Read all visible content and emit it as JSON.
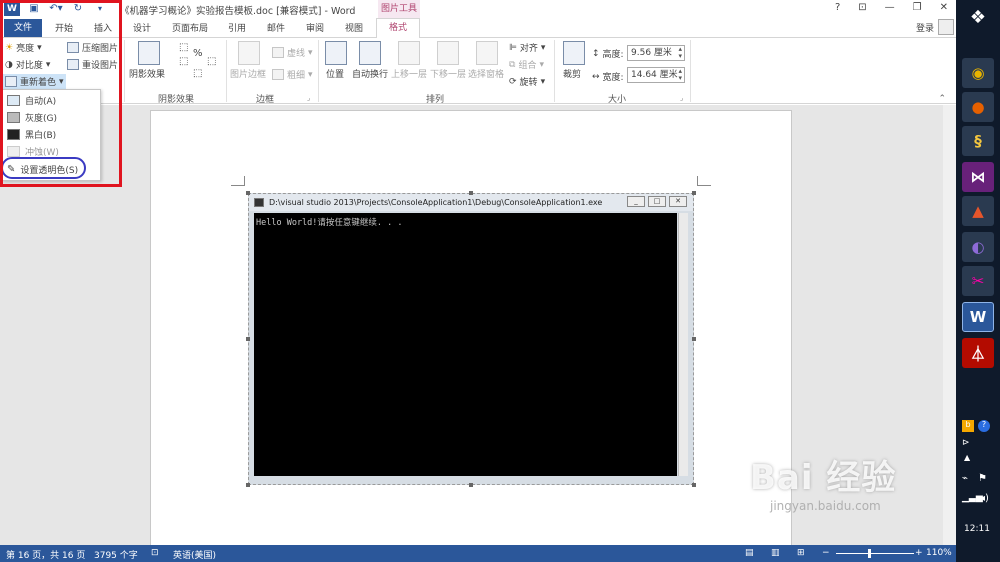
{
  "title_bar": {
    "document_title": "《机器学习概论》实验报告模板.doc [兼容模式] - Word",
    "contextual_tab": "图片工具",
    "help": "?",
    "ribbon_display": "⊡",
    "minimize": "—",
    "restore": "❐",
    "close": "✕"
  },
  "tabs": {
    "file": "文件",
    "home": "开始",
    "insert": "插入",
    "design": "设计",
    "layout": "页面布局",
    "references": "引用",
    "mailings": "邮件",
    "review": "审阅",
    "view": "视图",
    "format": "格式",
    "sign_in": "登录"
  },
  "ribbon": {
    "adjust": {
      "brightness": "亮度",
      "contrast": "对比度",
      "recolor": "重新着色",
      "compress": "压缩图片",
      "reset": "重设图片"
    },
    "shadow": {
      "shadow_effects": "阴影效果",
      "group_label": "阴影效果"
    },
    "border": {
      "picture_border": "图片边框",
      "dashes": "虚线",
      "weight": "粗细",
      "group_label": "边框"
    },
    "arrange": {
      "position": "位置",
      "wrap_text": "自动换行",
      "bring_forward": "上移一层",
      "send_backward": "下移一层",
      "selection_pane": "选择窗格",
      "align": "对齐",
      "group": "组合",
      "rotate": "旋转",
      "group_label": "排列"
    },
    "size": {
      "crop": "裁剪",
      "height_label": "高度:",
      "height_value": "9.56 厘米",
      "width_label": "宽度:",
      "width_value": "14.64 厘米",
      "group_label": "大小"
    }
  },
  "recolor_menu": {
    "items": [
      {
        "label": "自动(A)"
      },
      {
        "label": "灰度(G)"
      },
      {
        "label": "黑白(B)"
      },
      {
        "label": "冲蚀(W)"
      },
      {
        "label": "设置透明色(S)"
      }
    ]
  },
  "console": {
    "title": "D:\\visual studio 2013\\Projects\\ConsoleApplication1\\Debug\\ConsoleApplication1.exe",
    "output": "Hello World!请按任意键继续. . ."
  },
  "status_bar": {
    "page": "第 16 页，共 16 页",
    "words": "3795 个字",
    "language": "英语(美国)",
    "zoom": "110%"
  },
  "taskbar": {
    "clock": "12:11"
  },
  "watermark": {
    "main": "Bai 经验",
    "sub": "jingyan.baidu.com"
  },
  "colors": {
    "accent": "#2b579a",
    "picture_tools": "#b0446f",
    "highlight_box": "#e0141f",
    "ring": "#3b3bc2"
  }
}
